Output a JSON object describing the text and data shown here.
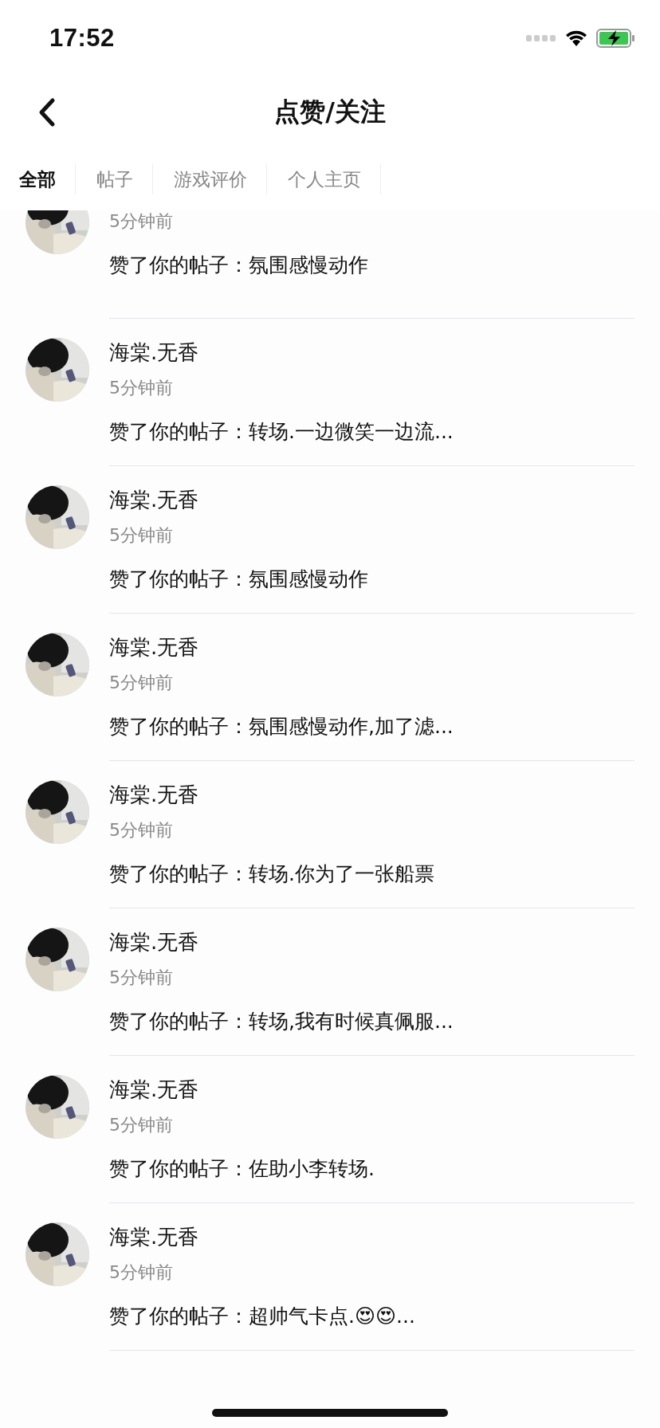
{
  "status_bar": {
    "time": "17:52"
  },
  "nav": {
    "title": "点赞/关注"
  },
  "tabs": [
    {
      "label": "全部",
      "selected": true
    },
    {
      "label": "帖子",
      "selected": false
    },
    {
      "label": "游戏评价",
      "selected": false
    },
    {
      "label": "个人主页",
      "selected": false
    }
  ],
  "notifications": [
    {
      "time": "5分钟前",
      "text": "赞了你的帖子：氛围感慢动作"
    },
    {
      "name": "海棠.无香",
      "time": "5分钟前",
      "text": "赞了你的帖子：转场.一边微笑一边流..."
    },
    {
      "name": "海棠.无香",
      "time": "5分钟前",
      "text": "赞了你的帖子：氛围感慢动作"
    },
    {
      "name": "海棠.无香",
      "time": "5分钟前",
      "text": "赞了你的帖子：氛围感慢动作,加了滤..."
    },
    {
      "name": "海棠.无香",
      "time": "5分钟前",
      "text": "赞了你的帖子：转场.你为了一张船票"
    },
    {
      "name": "海棠.无香",
      "time": "5分钟前",
      "text": "赞了你的帖子：转场,我有时候真佩服..."
    },
    {
      "name": "海棠.无香",
      "time": "5分钟前",
      "text": "赞了你的帖子：佐助小李转场."
    },
    {
      "name": "海棠.无香",
      "time": "5分钟前",
      "text": "赞了你的帖子：超帅气卡点.😍😍..."
    }
  ]
}
